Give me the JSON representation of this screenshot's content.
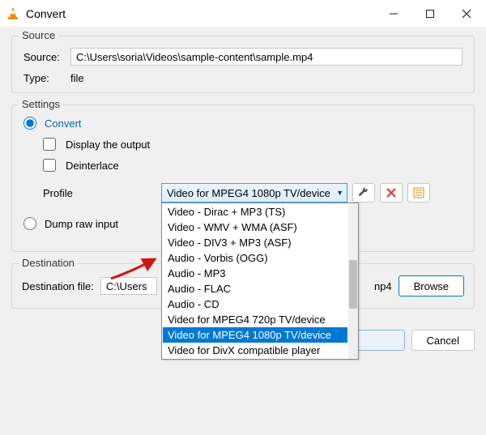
{
  "window": {
    "title": "Convert"
  },
  "source": {
    "legend": "Source",
    "source_label": "Source:",
    "source_value": "C:\\Users\\soria\\Videos\\sample-content\\sample.mp4",
    "type_label": "Type:",
    "type_value": "file"
  },
  "settings": {
    "legend": "Settings",
    "convert_label": "Convert",
    "display_output": "Display the output",
    "deinterlace": "Deinterlace",
    "profile_label": "Profile",
    "profile_selected": "Video for MPEG4 1080p TV/device",
    "profile_options": [
      "Video - Dirac + MP3 (TS)",
      "Video - WMV + WMA (ASF)",
      "Video - DIV3 + MP3 (ASF)",
      "Audio - Vorbis (OGG)",
      "Audio - MP3",
      "Audio - FLAC",
      "Audio - CD",
      "Video for MPEG4 720p TV/device",
      "Video for MPEG4 1080p TV/device",
      "Video for DivX compatible player"
    ],
    "dump_label": "Dump raw input"
  },
  "destination": {
    "legend": "Destination",
    "label": "Destination file:",
    "value": "C:\\Users",
    "suffix": "np4",
    "browse": "Browse"
  },
  "footer": {
    "cancel": "Cancel"
  }
}
